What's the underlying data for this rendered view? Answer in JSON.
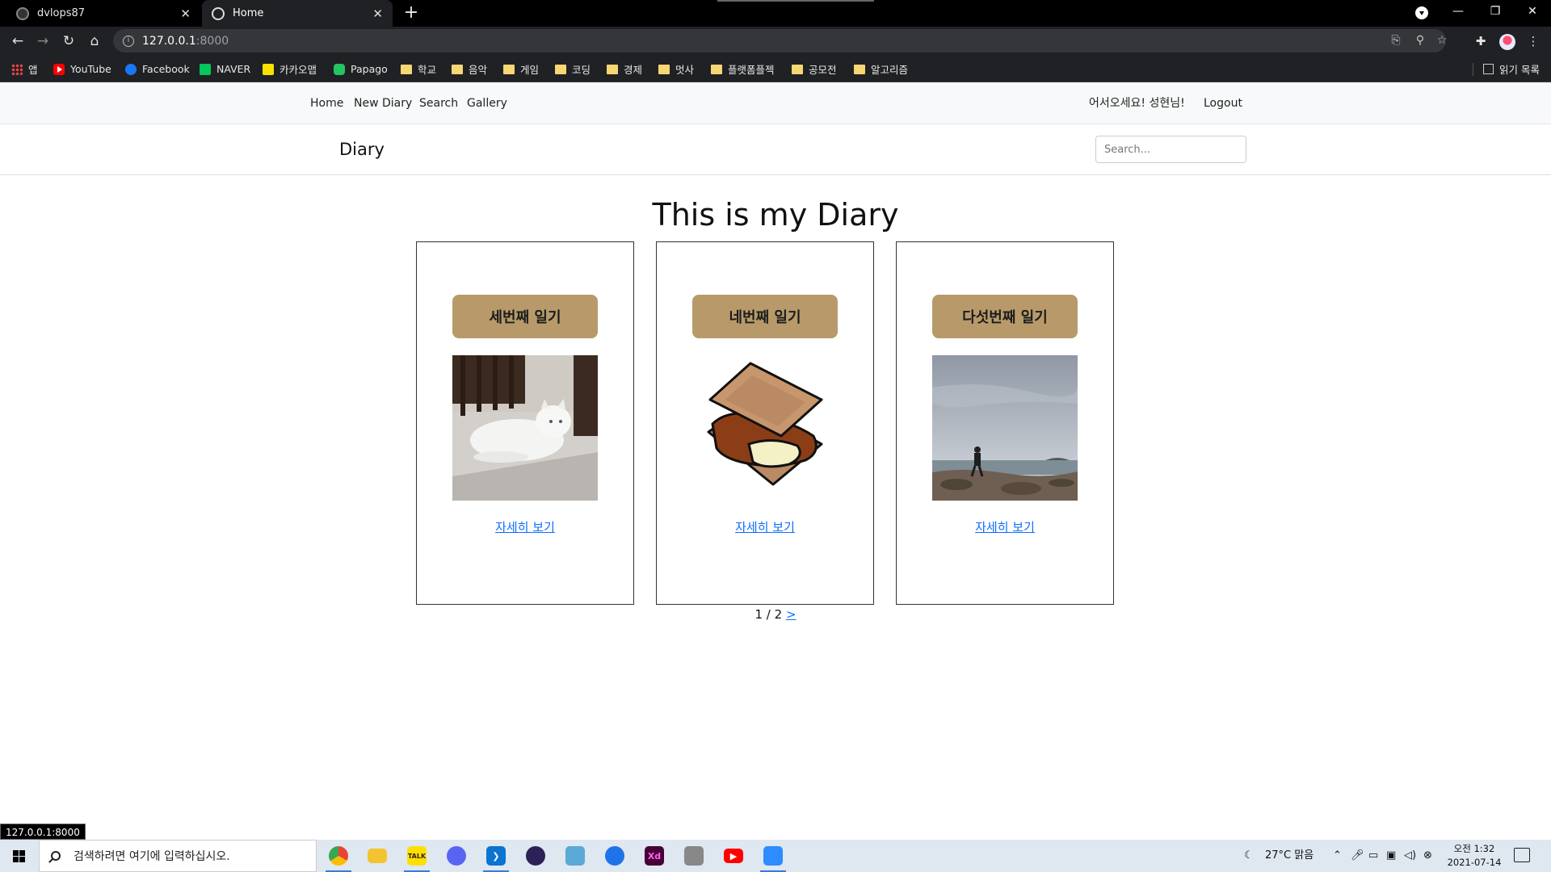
{
  "browser": {
    "tabs": [
      {
        "title": "dvlops87",
        "active": false
      },
      {
        "title": "Home",
        "active": true
      }
    ],
    "url_host": "127.0.0.1",
    "url_port": ":8000",
    "bookmarks": [
      {
        "label": "앱",
        "icon": "apps-grid-icon"
      },
      {
        "label": "YouTube",
        "icon": "youtube-icon"
      },
      {
        "label": "Facebook",
        "icon": "facebook-icon"
      },
      {
        "label": "NAVER",
        "icon": "naver-icon"
      },
      {
        "label": "카카오맵",
        "icon": "kakaomap-icon"
      },
      {
        "label": "Papago",
        "icon": "papago-icon"
      },
      {
        "label": "학교",
        "icon": "folder-icon"
      },
      {
        "label": "음악",
        "icon": "folder-icon"
      },
      {
        "label": "게임",
        "icon": "folder-icon"
      },
      {
        "label": "코딩",
        "icon": "folder-icon"
      },
      {
        "label": "경제",
        "icon": "folder-icon"
      },
      {
        "label": "멋사",
        "icon": "folder-icon"
      },
      {
        "label": "플랫폼플젝",
        "icon": "folder-icon"
      },
      {
        "label": "공모전",
        "icon": "folder-icon"
      },
      {
        "label": "알고리즘",
        "icon": "folder-icon"
      }
    ],
    "reading_list": "읽기 목록",
    "status_url": "127.0.0.1:8000"
  },
  "nav": {
    "links": [
      "Home",
      "New Diary",
      "Search",
      "Gallery"
    ],
    "greeting": "어서오세요! 성현님!",
    "logout": "Logout"
  },
  "header": {
    "brand": "Diary",
    "search_placeholder": "Search..."
  },
  "main": {
    "title": "This is my Diary",
    "cards": [
      {
        "title": "세번째 일기",
        "link": "자세히 보기",
        "image": "cat-photo"
      },
      {
        "title": "네번째 일기",
        "link": "자세히 보기",
        "image": "smores-illustration"
      },
      {
        "title": "다섯번째 일기",
        "link": "자세히 보기",
        "image": "beach-photo"
      }
    ],
    "pagination": {
      "current": "1",
      "sep": " / ",
      "total": "2",
      "next": ">"
    }
  },
  "taskbar": {
    "search_placeholder": "검색하려면 여기에 입력하십시오.",
    "weather": "27°C  맑음",
    "time": "오전 1:32",
    "date": "2021-07-14"
  },
  "colors": {
    "card_button": "#b89a6a",
    "link": "#0d6efd",
    "nav_bg": "#f8f9fa"
  }
}
